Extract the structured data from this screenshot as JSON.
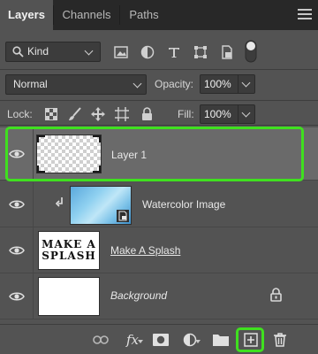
{
  "tabs": [
    {
      "label": "Layers",
      "active": true
    },
    {
      "label": "Channels",
      "active": false
    },
    {
      "label": "Paths",
      "active": false
    }
  ],
  "filter": {
    "kind_label": "Kind",
    "icons": [
      "image-filter-icon",
      "adjustment-filter-icon",
      "type-filter-icon",
      "shape-filter-icon",
      "smart-object-filter-icon"
    ]
  },
  "blend": {
    "mode": "Normal",
    "opacity_label": "Opacity:",
    "opacity_value": "100%"
  },
  "lock": {
    "label": "Lock:",
    "fill_label": "Fill:",
    "fill_value": "100%"
  },
  "layers": [
    {
      "name": "Layer 1",
      "selected": true,
      "visible": true,
      "thumbnail": "transparent"
    },
    {
      "name": "Watercolor Image",
      "selected": false,
      "visible": true,
      "thumbnail": "watercolor",
      "clipped": true
    },
    {
      "name": "Make A Splash",
      "selected": false,
      "visible": true,
      "thumbnail": "text",
      "thumb_text": "MAKE A SPLASH"
    },
    {
      "name": "Background",
      "selected": false,
      "visible": true,
      "thumbnail": "white",
      "locked": true
    }
  ],
  "bottom_icons": [
    "link-icon",
    "fx-icon",
    "mask-icon",
    "adjustment-icon",
    "folder-icon",
    "new-layer-icon",
    "trash-icon"
  ],
  "colors": {
    "panel_bg": "#535353",
    "tab_bar_bg": "#282828",
    "selected_row": "#6a6a6a",
    "highlight_green": "#3fe01f"
  },
  "fx_label": "fx"
}
